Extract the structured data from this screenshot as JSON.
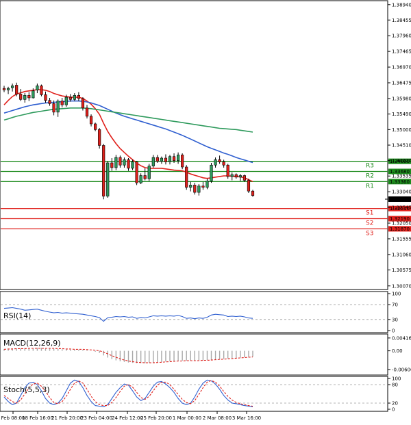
{
  "chart_data": {
    "type": "candlestick",
    "instrument": "",
    "price_axis": {
      "ticks": [
        1.3894,
        1.38455,
        1.3796,
        1.37465,
        1.3697,
        1.36475,
        1.3598,
        1.3549,
        1.35,
        1.3451,
        1.3402,
        1.33535,
        1.3304,
        1.32545,
        1.3205,
        1.31555,
        1.3106,
        1.30575,
        1.3007
      ],
      "tick_labels": [
        "1.38940",
        "1.38455",
        "1.37960",
        "1.37465",
        "1.36970",
        "1.36475",
        "1.35980",
        "1.35490",
        "1.35000",
        "1.34510",
        "1.34020",
        "1.33535",
        "1.33040",
        "1.32545",
        "1.32050",
        "1.31555",
        "1.31060",
        "1.30575",
        "1.30070"
      ],
      "range": [
        1.3,
        1.39
      ]
    },
    "time_axis": {
      "labels": [
        "Feb 08:00",
        "18 Feb 16:00",
        "21 Feb 20:00",
        "23 Feb 04:00",
        "24 Feb 12:00",
        "25 Feb 20:00",
        "1 Mar 00:00",
        "2 Mar 08:00",
        "3 Mar 16:00"
      ]
    },
    "candles": [
      {
        "o": 1.363,
        "h": 1.3638,
        "l": 1.3618,
        "c": 1.3625
      },
      {
        "o": 1.3625,
        "h": 1.3635,
        "l": 1.3612,
        "c": 1.363
      },
      {
        "o": 1.3632,
        "h": 1.3645,
        "l": 1.362,
        "c": 1.3638
      },
      {
        "o": 1.364,
        "h": 1.3648,
        "l": 1.3605,
        "c": 1.3612
      },
      {
        "o": 1.3612,
        "h": 1.3628,
        "l": 1.359,
        "c": 1.3595
      },
      {
        "o": 1.3595,
        "h": 1.3615,
        "l": 1.3585,
        "c": 1.3608
      },
      {
        "o": 1.3608,
        "h": 1.3618,
        "l": 1.359,
        "c": 1.36
      },
      {
        "o": 1.36,
        "h": 1.363,
        "l": 1.3598,
        "c": 1.3622
      },
      {
        "o": 1.3625,
        "h": 1.3645,
        "l": 1.3615,
        "c": 1.3638
      },
      {
        "o": 1.3638,
        "h": 1.3642,
        "l": 1.3605,
        "c": 1.361
      },
      {
        "o": 1.361,
        "h": 1.362,
        "l": 1.3585,
        "c": 1.3592
      },
      {
        "o": 1.3592,
        "h": 1.36,
        "l": 1.3575,
        "c": 1.3582
      },
      {
        "o": 1.3582,
        "h": 1.3592,
        "l": 1.3545,
        "c": 1.3555
      },
      {
        "o": 1.3555,
        "h": 1.3595,
        "l": 1.354,
        "c": 1.359
      },
      {
        "o": 1.359,
        "h": 1.36,
        "l": 1.357,
        "c": 1.3578
      },
      {
        "o": 1.3578,
        "h": 1.361,
        "l": 1.3572,
        "c": 1.3602
      },
      {
        "o": 1.3602,
        "h": 1.3612,
        "l": 1.3588,
        "c": 1.3595
      },
      {
        "o": 1.3595,
        "h": 1.3615,
        "l": 1.359,
        "c": 1.3608
      },
      {
        "o": 1.3608,
        "h": 1.3618,
        "l": 1.359,
        "c": 1.3598
      },
      {
        "o": 1.3598,
        "h": 1.3602,
        "l": 1.356,
        "c": 1.3568
      },
      {
        "o": 1.3568,
        "h": 1.3578,
        "l": 1.3535,
        "c": 1.3542
      },
      {
        "o": 1.3542,
        "h": 1.3548,
        "l": 1.351,
        "c": 1.3518
      },
      {
        "o": 1.3518,
        "h": 1.3522,
        "l": 1.3495,
        "c": 1.35
      },
      {
        "o": 1.35,
        "h": 1.3505,
        "l": 1.344,
        "c": 1.345
      },
      {
        "o": 1.345,
        "h": 1.3455,
        "l": 1.328,
        "c": 1.329
      },
      {
        "o": 1.329,
        "h": 1.34,
        "l": 1.3285,
        "c": 1.3395
      },
      {
        "o": 1.3395,
        "h": 1.341,
        "l": 1.337,
        "c": 1.338
      },
      {
        "o": 1.338,
        "h": 1.342,
        "l": 1.3372,
        "c": 1.3412
      },
      {
        "o": 1.3412,
        "h": 1.3418,
        "l": 1.338,
        "c": 1.3388
      },
      {
        "o": 1.3388,
        "h": 1.3412,
        "l": 1.338,
        "c": 1.3405
      },
      {
        "o": 1.3405,
        "h": 1.341,
        "l": 1.337,
        "c": 1.3378
      },
      {
        "o": 1.3378,
        "h": 1.3405,
        "l": 1.3372,
        "c": 1.3398
      },
      {
        "o": 1.3398,
        "h": 1.34,
        "l": 1.3325,
        "c": 1.3332
      },
      {
        "o": 1.3332,
        "h": 1.3362,
        "l": 1.3328,
        "c": 1.3355
      },
      {
        "o": 1.3355,
        "h": 1.3378,
        "l": 1.334,
        "c": 1.3345
      },
      {
        "o": 1.3345,
        "h": 1.3392,
        "l": 1.3338,
        "c": 1.3385
      },
      {
        "o": 1.3385,
        "h": 1.342,
        "l": 1.338,
        "c": 1.3412
      },
      {
        "o": 1.3412,
        "h": 1.342,
        "l": 1.3395,
        "c": 1.34
      },
      {
        "o": 1.34,
        "h": 1.3415,
        "l": 1.3392,
        "c": 1.341
      },
      {
        "o": 1.341,
        "h": 1.3422,
        "l": 1.339,
        "c": 1.3398
      },
      {
        "o": 1.3398,
        "h": 1.342,
        "l": 1.339,
        "c": 1.3415
      },
      {
        "o": 1.3415,
        "h": 1.3425,
        "l": 1.3395,
        "c": 1.3402
      },
      {
        "o": 1.3402,
        "h": 1.3428,
        "l": 1.3392,
        "c": 1.342
      },
      {
        "o": 1.342,
        "h": 1.3425,
        "l": 1.3375,
        "c": 1.3382
      },
      {
        "o": 1.3382,
        "h": 1.3388,
        "l": 1.331,
        "c": 1.3318
      },
      {
        "o": 1.3318,
        "h": 1.3335,
        "l": 1.3305,
        "c": 1.3325
      },
      {
        "o": 1.3325,
        "h": 1.3332,
        "l": 1.3295,
        "c": 1.3302
      },
      {
        "o": 1.3302,
        "h": 1.3328,
        "l": 1.3292,
        "c": 1.3322
      },
      {
        "o": 1.3322,
        "h": 1.3335,
        "l": 1.331,
        "c": 1.3318
      },
      {
        "o": 1.3318,
        "h": 1.3345,
        "l": 1.3312,
        "c": 1.3338
      },
      {
        "o": 1.3338,
        "h": 1.3395,
        "l": 1.3332,
        "c": 1.3388
      },
      {
        "o": 1.3388,
        "h": 1.3412,
        "l": 1.338,
        "c": 1.3405
      },
      {
        "o": 1.3405,
        "h": 1.3418,
        "l": 1.3392,
        "c": 1.3398
      },
      {
        "o": 1.3398,
        "h": 1.3405,
        "l": 1.338,
        "c": 1.3388
      },
      {
        "o": 1.3388,
        "h": 1.3392,
        "l": 1.3345,
        "c": 1.3352
      },
      {
        "o": 1.3352,
        "h": 1.3365,
        "l": 1.334,
        "c": 1.3358
      },
      {
        "o": 1.3358,
        "h": 1.3362,
        "l": 1.3345,
        "c": 1.335
      },
      {
        "o": 1.335,
        "h": 1.336,
        "l": 1.3338,
        "c": 1.3355
      },
      {
        "o": 1.3355,
        "h": 1.3358,
        "l": 1.3335,
        "c": 1.334
      },
      {
        "o": 1.334,
        "h": 1.3345,
        "l": 1.33,
        "c": 1.3306
      },
      {
        "o": 1.3306,
        "h": 1.331,
        "l": 1.3288,
        "c": 1.3292
      }
    ],
    "moving_averages": [
      {
        "color": "#e0201b",
        "values": [
          1.3578,
          1.3592,
          1.3604,
          1.3612,
          1.3616,
          1.362,
          1.3622,
          1.3624,
          1.3626,
          1.3626,
          1.3624,
          1.362,
          1.3614,
          1.361,
          1.3606,
          1.3604,
          1.3602,
          1.3602,
          1.3602,
          1.3598,
          1.359,
          1.358,
          1.3566,
          1.3548,
          1.352,
          1.3494,
          1.3474,
          1.3456,
          1.344,
          1.3428,
          1.3416,
          1.3405,
          1.3394,
          1.3386,
          1.338,
          1.3378,
          1.3378,
          1.3378,
          1.3378,
          1.3376,
          1.3374,
          1.3372,
          1.3371,
          1.337,
          1.3366,
          1.336,
          1.3356,
          1.3352,
          1.3348,
          1.3346,
          1.3348,
          1.335,
          1.3352,
          1.3354,
          1.3354,
          1.3353,
          1.3352,
          1.3351,
          1.3348,
          1.3342,
          1.3336
        ]
      },
      {
        "color": "#2f5fd0",
        "values": [
          1.3552,
          1.3556,
          1.356,
          1.3564,
          1.3568,
          1.3572,
          1.3575,
          1.3578,
          1.358,
          1.3582,
          1.3584,
          1.3585,
          1.3586,
          1.3587,
          1.3588,
          1.3589,
          1.359,
          1.359,
          1.359,
          1.3589,
          1.3587,
          1.3584,
          1.358,
          1.3576,
          1.357,
          1.3564,
          1.3558,
          1.3552,
          1.3547,
          1.3542,
          1.3538,
          1.3534,
          1.353,
          1.3526,
          1.3522,
          1.3518,
          1.3514,
          1.351,
          1.3506,
          1.3502,
          1.3497,
          1.3492,
          1.3487,
          1.3482,
          1.3476,
          1.347,
          1.3464,
          1.3458,
          1.3452,
          1.3446,
          1.3441,
          1.3436,
          1.3431,
          1.3426,
          1.3422,
          1.3417,
          1.3412,
          1.3408,
          1.3404,
          1.34,
          1.3396
        ]
      },
      {
        "color": "#2e9a5c",
        "values": [
          1.353,
          1.3534,
          1.3538,
          1.3542,
          1.3545,
          1.3548,
          1.3551,
          1.3554,
          1.3556,
          1.3558,
          1.356,
          1.3562,
          1.3564,
          1.3565,
          1.3566,
          1.3567,
          1.3568,
          1.3568,
          1.3568,
          1.3568,
          1.3567,
          1.3566,
          1.3564,
          1.3562,
          1.356,
          1.3558,
          1.3556,
          1.3554,
          1.3552,
          1.355,
          1.3548,
          1.3546,
          1.3544,
          1.3542,
          1.354,
          1.3538,
          1.3536,
          1.3534,
          1.3532,
          1.353,
          1.3528,
          1.3526,
          1.3524,
          1.3522,
          1.352,
          1.3518,
          1.3516,
          1.3514,
          1.3512,
          1.351,
          1.3508,
          1.3506,
          1.3504,
          1.3503,
          1.3502,
          1.3501,
          1.35,
          1.3498,
          1.3496,
          1.3494,
          1.3492
        ]
      }
    ],
    "levels": [
      {
        "name": "R3",
        "price": 1.34,
        "price_label": "1.34000",
        "color": "#1c8a1c"
      },
      {
        "name": "R2",
        "price": 1.3368,
        "price_label": "1.33680",
        "color": "#1c8a1c"
      },
      {
        "name": "R1",
        "price": 1.3336,
        "price_label": "1.33360",
        "color": "#1c8a1c"
      },
      {
        "name": "S1",
        "price": 1.3251,
        "price_label": "1.32510",
        "color": "#e0201b"
      },
      {
        "name": "S2",
        "price": 1.3219,
        "price_label": "1.32190",
        "color": "#e0201b"
      },
      {
        "name": "S3",
        "price": 1.3187,
        "price_label": "1.31870",
        "color": "#e0201b"
      }
    ],
    "last_price": {
      "value": 1.32806,
      "label": "1.32806"
    },
    "indicators": [
      {
        "id": "rsi",
        "title": "RSI(14)",
        "ticks": [
          100,
          70,
          30,
          0
        ],
        "tick_labels": [
          "100",
          "70",
          "30",
          "0"
        ],
        "range": [
          0,
          100
        ],
        "series": [
          {
            "color": "#2f5fd0",
            "dashed": false,
            "values": [
              60,
              61,
              62,
              60,
              58,
              55,
              56,
              57,
              58,
              55,
              52,
              50,
              48,
              49,
              47,
              48,
              47,
              46,
              45,
              44,
              42,
              40,
              38,
              35,
              25,
              35,
              36,
              38,
              37,
              38,
              36,
              37,
              33,
              35,
              34,
              37,
              40,
              39,
              40,
              39,
              40,
              39,
              41,
              38,
              33,
              34,
              32,
              34,
              33,
              36,
              42,
              44,
              43,
              42,
              38,
              39,
              38,
              39,
              37,
              34,
              33
            ]
          }
        ]
      },
      {
        "id": "macd",
        "title": "MACD(12,26,9)",
        "ticks": [
          0.004166,
          0.0,
          -0.006068
        ],
        "tick_labels": [
          "0.004166",
          "0.00",
          "-0.006068"
        ],
        "range": [
          -0.0072,
          0.0048
        ],
        "histogram": [
          0.0006,
          0.0007,
          0.0008,
          0.0008,
          0.0008,
          0.0009,
          0.0009,
          0.0009,
          0.001,
          0.001,
          0.0009,
          0.0008,
          0.0007,
          0.0006,
          0.0005,
          0.0005,
          0.0004,
          0.0004,
          0.0004,
          0.0003,
          0.0002,
          0.0,
          -0.0003,
          -0.0007,
          -0.0015,
          -0.0022,
          -0.0027,
          -0.0031,
          -0.0034,
          -0.0036,
          -0.0038,
          -0.0039,
          -0.004,
          -0.004,
          -0.004,
          -0.0039,
          -0.0038,
          -0.0037,
          -0.0036,
          -0.0035,
          -0.0034,
          -0.0033,
          -0.0032,
          -0.0032,
          -0.0032,
          -0.0032,
          -0.0032,
          -0.0032,
          -0.0031,
          -0.003,
          -0.0029,
          -0.0028,
          -0.0027,
          -0.0026,
          -0.0025,
          -0.0024,
          -0.0023,
          -0.0022,
          -0.0021,
          -0.002,
          -0.0019
        ],
        "series": [
          {
            "color": "#e0201b",
            "dashed": true,
            "values": [
              0.0005,
              0.0006,
              0.0006,
              0.0007,
              0.0007,
              0.0007,
              0.0008,
              0.0008,
              0.0008,
              0.0008,
              0.0008,
              0.0008,
              0.0008,
              0.0007,
              0.0007,
              0.0006,
              0.0006,
              0.0005,
              0.0005,
              0.0005,
              0.0004,
              0.0003,
              0.0002,
              0.0,
              -0.0004,
              -0.001,
              -0.0016,
              -0.0021,
              -0.0026,
              -0.003,
              -0.0033,
              -0.0035,
              -0.0037,
              -0.0038,
              -0.0039,
              -0.0039,
              -0.0039,
              -0.0038,
              -0.0037,
              -0.0036,
              -0.0035,
              -0.0034,
              -0.0033,
              -0.0033,
              -0.0032,
              -0.0032,
              -0.0032,
              -0.0032,
              -0.0031,
              -0.0031,
              -0.003,
              -0.0029,
              -0.0028,
              -0.0027,
              -0.0026,
              -0.0025,
              -0.0024,
              -0.0023,
              -0.0022,
              -0.0021,
              -0.002
            ]
          }
        ]
      },
      {
        "id": "stoch",
        "title": "Stoch(5,5,3)",
        "ticks": [
          100,
          80,
          20,
          0
        ],
        "tick_labels": [
          "100",
          "80",
          "20",
          "0"
        ],
        "range": [
          0,
          100
        ],
        "series": [
          {
            "color": "#2f5fd0",
            "dashed": false,
            "values": [
              40,
              25,
              15,
              20,
              45,
              70,
              85,
              88,
              80,
              60,
              35,
              20,
              15,
              20,
              35,
              60,
              85,
              95,
              90,
              70,
              45,
              25,
              12,
              10,
              8,
              15,
              35,
              55,
              70,
              82,
              78,
              60,
              40,
              28,
              35,
              55,
              75,
              88,
              90,
              82,
              70,
              55,
              35,
              20,
              15,
              20,
              40,
              65,
              85,
              95,
              92,
              82,
              65,
              45,
              30,
              20,
              18,
              15,
              12,
              10,
              8
            ]
          },
          {
            "color": "#e0201b",
            "dashed": true,
            "values": [
              45,
              35,
              25,
              20,
              30,
              50,
              70,
              82,
              85,
              75,
              58,
              38,
              22,
              18,
              25,
              42,
              65,
              85,
              92,
              85,
              65,
              42,
              25,
              15,
              12,
              12,
              22,
              38,
              58,
              75,
              80,
              72,
              55,
              38,
              32,
              42,
              60,
              78,
              88,
              88,
              80,
              65,
              48,
              32,
              22,
              18,
              28,
              48,
              70,
              88,
              93,
              88,
              75,
              58,
              42,
              30,
              22,
              18,
              15,
              12,
              10
            ]
          }
        ]
      }
    ]
  }
}
